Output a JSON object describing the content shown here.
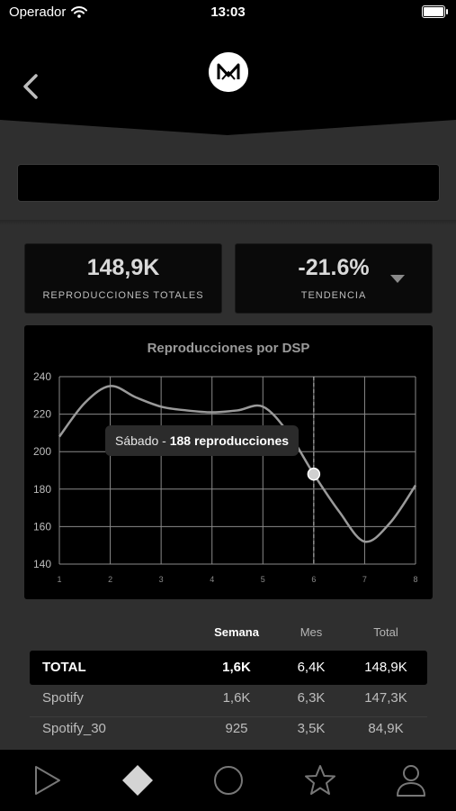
{
  "status_bar": {
    "carrier": "Operador",
    "time": "13:03"
  },
  "stats": {
    "total_value": "148,9K",
    "total_label": "REPRODUCCIONES TOTALES",
    "trend_value": "-21.6%",
    "trend_label": "TENDENCIA"
  },
  "chart_data": {
    "type": "line",
    "title": "Reproducciones por DSP",
    "x": [
      1,
      1.5,
      2,
      2.5,
      3,
      3.5,
      4,
      4.5,
      5,
      5.5,
      6,
      6.5,
      7,
      7.5,
      8
    ],
    "y": [
      208,
      226,
      235,
      229,
      224,
      222,
      221,
      222,
      224,
      210,
      188,
      168,
      152,
      162,
      182
    ],
    "xlim": [
      1,
      8
    ],
    "ylim": [
      140,
      240
    ],
    "xticks": [
      "1",
      "2",
      "3",
      "4",
      "5",
      "6",
      "7",
      "8"
    ],
    "yticks": [
      "240",
      "220",
      "200",
      "180",
      "160",
      "140"
    ],
    "grid": true,
    "highlight": {
      "x": 6,
      "y": 188
    },
    "tooltip_day": "Sábado",
    "tooltip_sep": " - ",
    "tooltip_value": "188 reproducciones",
    "line_color": "#9a9a9a"
  },
  "table": {
    "headers": {
      "week": "Semana",
      "month": "Mes",
      "total": "Total"
    },
    "rows": [
      {
        "name": "TOTAL",
        "week": "1,6K",
        "month": "6,4K",
        "total": "148,9K"
      },
      {
        "name": "Spotify",
        "week": "1,6K",
        "month": "6,3K",
        "total": "147,3K"
      },
      {
        "name": "Spotify_30",
        "week": "925",
        "month": "3,5K",
        "total": "84,9K"
      }
    ]
  },
  "tabs": [
    {
      "icon": "play-icon"
    },
    {
      "icon": "diamond-icon"
    },
    {
      "icon": "circle-icon"
    },
    {
      "icon": "star-icon"
    },
    {
      "icon": "user-icon"
    }
  ]
}
